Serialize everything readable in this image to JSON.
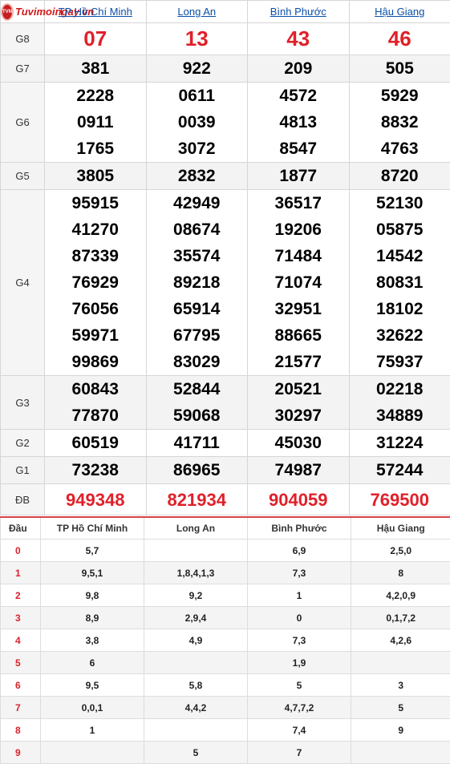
{
  "site": {
    "logo_text": "Tuvimoingay.vn",
    "logo_badge": "TVN"
  },
  "provinces": [
    "TP Hồ Chí Minh",
    "Long An",
    "Bình Phước",
    "Hậu Giang"
  ],
  "prizes": [
    {
      "label": "G8",
      "values": [
        [
          "07"
        ],
        [
          "13"
        ],
        [
          "43"
        ],
        [
          "46"
        ]
      ]
    },
    {
      "label": "G7",
      "values": [
        [
          "381"
        ],
        [
          "922"
        ],
        [
          "209"
        ],
        [
          "505"
        ]
      ]
    },
    {
      "label": "G6",
      "values": [
        [
          "2228",
          "0911",
          "1765"
        ],
        [
          "0611",
          "0039",
          "3072"
        ],
        [
          "4572",
          "4813",
          "8547"
        ],
        [
          "5929",
          "8832",
          "4763"
        ]
      ]
    },
    {
      "label": "G5",
      "values": [
        [
          "3805"
        ],
        [
          "2832"
        ],
        [
          "1877"
        ],
        [
          "8720"
        ]
      ]
    },
    {
      "label": "G4",
      "values": [
        [
          "95915",
          "41270",
          "87339",
          "76929",
          "76056",
          "59971",
          "99869"
        ],
        [
          "42949",
          "08674",
          "35574",
          "89218",
          "65914",
          "67795",
          "83029"
        ],
        [
          "36517",
          "19206",
          "71484",
          "71074",
          "32951",
          "88665",
          "21577"
        ],
        [
          "52130",
          "05875",
          "14542",
          "80831",
          "18102",
          "32622",
          "75937"
        ]
      ]
    },
    {
      "label": "G3",
      "values": [
        [
          "60843",
          "77870"
        ],
        [
          "52844",
          "59068"
        ],
        [
          "20521",
          "30297"
        ],
        [
          "02218",
          "34889"
        ]
      ]
    },
    {
      "label": "G2",
      "values": [
        [
          "60519"
        ],
        [
          "41711"
        ],
        [
          "45030"
        ],
        [
          "31224"
        ]
      ]
    },
    {
      "label": "G1",
      "values": [
        [
          "73238"
        ],
        [
          "86965"
        ],
        [
          "74987"
        ],
        [
          "57244"
        ]
      ]
    },
    {
      "label": "ĐB",
      "values": [
        [
          "949348"
        ],
        [
          "821934"
        ],
        [
          "904059"
        ],
        [
          "769500"
        ]
      ]
    }
  ],
  "colors": {
    "special_prize": "#e0202a",
    "link": "#0b4fa8"
  },
  "stats": {
    "header": [
      "Đầu",
      "TP Hồ Chí Minh",
      "Long An",
      "Bình Phước",
      "Hậu Giang"
    ],
    "rows": [
      [
        "0",
        "5,7",
        "",
        "6,9",
        "2,5,0"
      ],
      [
        "1",
        "9,5,1",
        "1,8,4,1,3",
        "7,3",
        "8"
      ],
      [
        "2",
        "9,8",
        "9,2",
        "1",
        "4,2,0,9"
      ],
      [
        "3",
        "8,9",
        "2,9,4",
        "0",
        "0,1,7,2"
      ],
      [
        "4",
        "3,8",
        "4,9",
        "7,3",
        "4,2,6"
      ],
      [
        "5",
        "6",
        "",
        "1,9",
        ""
      ],
      [
        "6",
        "9,5",
        "5,8",
        "5",
        "3"
      ],
      [
        "7",
        "0,0,1",
        "4,4,2",
        "4,7,7,2",
        "5"
      ],
      [
        "8",
        "1",
        "",
        "7,4",
        "9"
      ],
      [
        "9",
        "",
        "5",
        "7",
        ""
      ]
    ]
  }
}
